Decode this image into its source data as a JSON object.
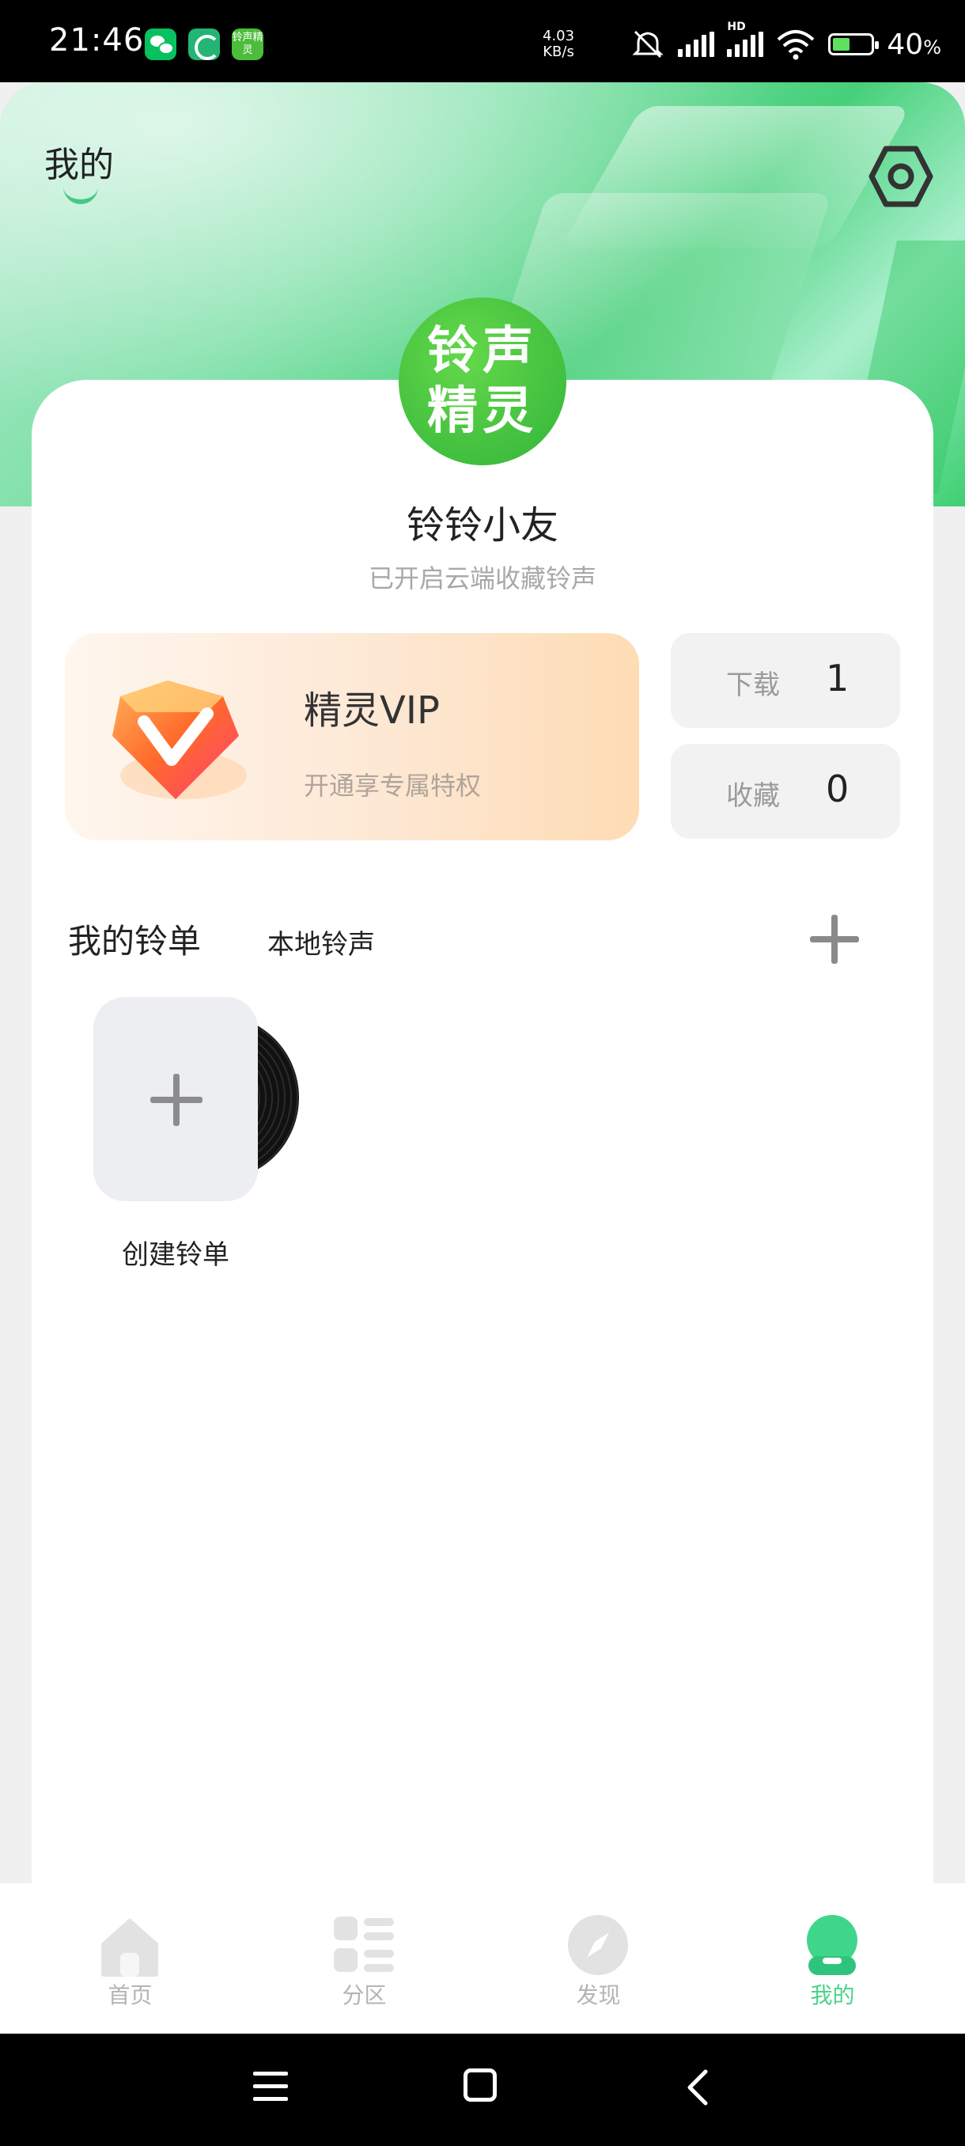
{
  "status_bar": {
    "time": "21:46",
    "net_speed_value": "4.03",
    "net_speed_unit": "KB/s",
    "hd_label": "HD",
    "battery_percent": "40",
    "percent_sign": "%",
    "app_icon_ling": "铃声精灵",
    "icons": [
      "wechat-icon",
      "swirl-app-icon",
      "ringtone-app-icon",
      "mute-icon",
      "signal-icon",
      "wifi-icon",
      "battery-icon"
    ]
  },
  "header": {
    "title": "我的",
    "settings_icon": "settings-gear-icon"
  },
  "profile": {
    "avatar_line1": "铃声",
    "avatar_line2": "精灵",
    "username": "铃铃小友",
    "subtitle": "已开启云端收藏铃声"
  },
  "vip": {
    "title": "精灵VIP",
    "subtitle": "开通享专属特权",
    "icon": "vip-diamond-icon"
  },
  "stats": {
    "download_label": "下载",
    "download_value": "1",
    "favorite_label": "收藏",
    "favorite_value": "0"
  },
  "playlist_tabs": {
    "mine": "我的铃单",
    "local": "本地铃声"
  },
  "playlists": {
    "create_label": "创建铃单"
  },
  "bottom_nav": {
    "items": [
      {
        "label": "首页",
        "icon": "home-icon"
      },
      {
        "label": "分区",
        "icon": "category-icon"
      },
      {
        "label": "发现",
        "icon": "compass-icon"
      },
      {
        "label": "我的",
        "icon": "profile-icon"
      }
    ],
    "active_index": 3
  },
  "colors": {
    "accent": "#4cd38a",
    "vip_gradient": "#fedcb4",
    "avatar": "#32b43a"
  }
}
